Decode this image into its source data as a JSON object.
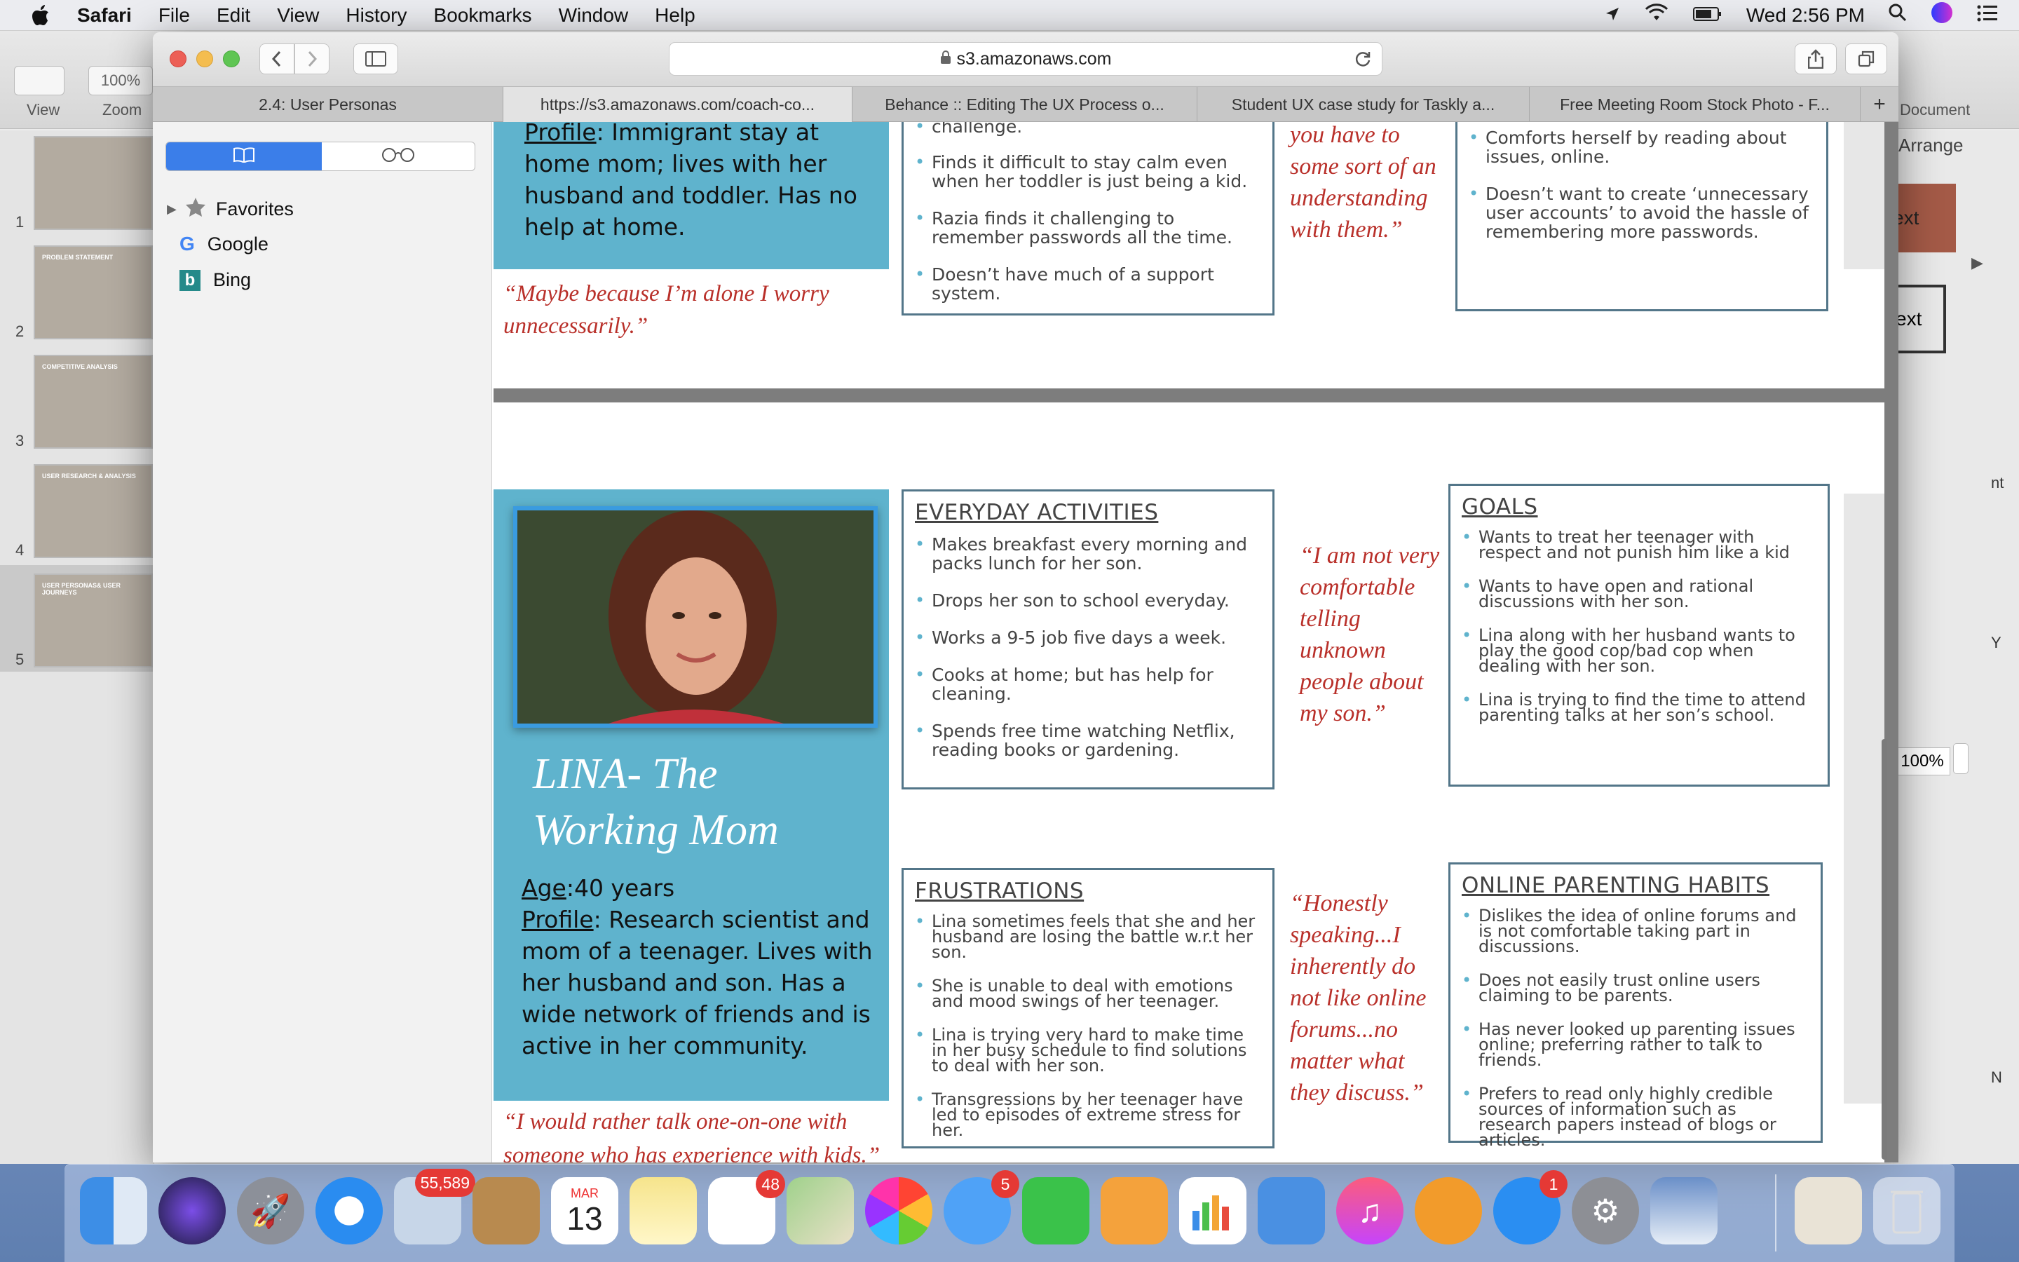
{
  "menubar": {
    "app_name": "Safari",
    "items": [
      "File",
      "Edit",
      "View",
      "History",
      "Bookmarks",
      "Window",
      "Help"
    ],
    "clock": "Wed 2:56 PM"
  },
  "keynote": {
    "toolbar": {
      "view_label": "View",
      "zoom_label": "Zoom",
      "zoom_value": "100%",
      "document_label": "Document"
    },
    "slide_numbers": [
      "1",
      "2",
      "3",
      "4",
      "5"
    ],
    "slide_titles": [
      "",
      "PROBLEM STATEMENT",
      "COMPETITIVE ANALYSIS",
      "USER RESEARCH & ANALYSIS",
      "USER PERSONAS& USER JOURNEYS"
    ],
    "arrange_label": "Arrange",
    "text_btn1": "ext",
    "text_btn2": "ext",
    "zoom_field": "100%",
    "frag_nt": "nt",
    "frag_y": "Y",
    "frag_n": "N"
  },
  "safari": {
    "url": "s3.amazonaws.com",
    "tabs": [
      {
        "label": "2.4: User Personas"
      },
      {
        "label": "https://s3.amazonaws.com/coach-co..."
      },
      {
        "label": "Behance :: Editing The UX Process o..."
      },
      {
        "label": "Student UX case study for Taskly a..."
      },
      {
        "label": "Free Meeting Room Stock Photo - F..."
      }
    ],
    "sidebar": {
      "favorites": "Favorites",
      "google": "Google",
      "bing": "Bing"
    }
  },
  "persona_top": {
    "profile_label": "Profile",
    "profile_text": ": Immigrant stay at home mom; lives with her husband and toddler. Has no help at home.",
    "quote_left": "“Maybe because I’m alone I worry unnecessarily.”",
    "frustrations_partial": [
      "challenge.",
      "Finds it difficult to stay calm even when her toddler is just being a kid.",
      "Razia finds it challenging to remember passwords all the time.",
      "Doesn’t have much of a support system."
    ],
    "quote_mid": "you have to some sort of an understanding with them.”",
    "habits_partial": [
      "Comforts herself by reading about issues, online.",
      "Doesn’t want to create ‘unnecessary user accounts’ to avoid the hassle of remembering more passwords."
    ]
  },
  "persona_lina": {
    "name_line1": "LINA- The",
    "name_line2": "Working Mom",
    "age_label": "Age",
    "age_value": ":40 years",
    "profile_label": "Profile",
    "profile_text": ": Research scientist and mom of a teenager. Lives with her husband and son. Has a wide network of friends and is active in her community.",
    "quote_bottom": "“I would rather talk one-on-one with someone who has experience with kids.”",
    "everyday_title": "EVERYDAY ACTIVITIES",
    "everyday": [
      "Makes breakfast every morning and packs lunch for her son.",
      "Drops her son to school everyday.",
      "Works a 9-5 job five days a week.",
      "Cooks at home; but has help for cleaning.",
      "Spends free time watching Netflix, reading books or gardening."
    ],
    "quote_1": "“I am not very comfortable telling unknown people about my son.”",
    "goals_title": "GOALS",
    "goals": [
      "Wants to treat her teenager with respect and not punish him like a kid",
      "Wants to have open and rational discussions with her son.",
      "Lina along with her husband wants to play the good cop/bad cop when dealing with her son.",
      "Lina is trying to find the time to attend parenting talks  at her son’s school."
    ],
    "frustrations_title": "FRUSTRATIONS",
    "frustrations": [
      "Lina sometimes feels that she and her husband are losing the battle w.r.t her son.",
      "She is unable to deal with emotions and mood swings of her teenager.",
      "Lina is trying very hard to make time in her busy schedule to find solutions to deal with her son.",
      "Transgressions by her teenager have led to episodes of extreme stress for her."
    ],
    "quote_2": "“Honestly speaking...I inherently do not like online forums...no matter what they discuss.”",
    "habits_title": "ONLINE PARENTING HABITS",
    "habits": [
      "Dislikes the idea of online forums and is not comfortable taking part in discussions.",
      "Does not easily trust online users claiming to be parents.",
      "Has never looked up parenting issues online; preferring rather to talk to friends.",
      "Prefers to read only highly credible sources of information such as research papers instead of blogs or articles."
    ]
  },
  "dock": {
    "mail_badge": "55,589",
    "reminders_badge": "48",
    "messages_badge": "5",
    "appstore_badge": "1",
    "calendar_month": "MAR",
    "calendar_day": "13"
  }
}
